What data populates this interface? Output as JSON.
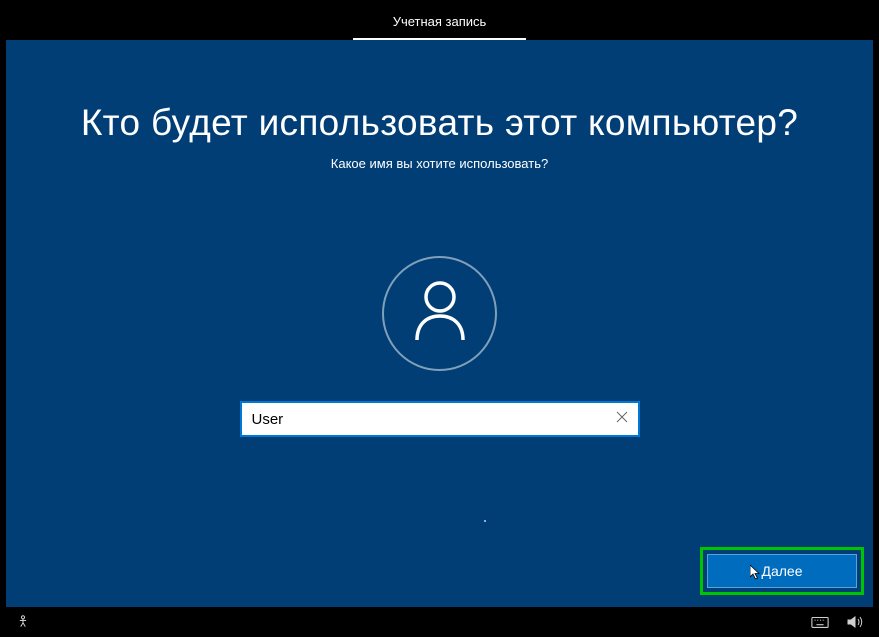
{
  "header": {
    "tab_label": "Учетная запись"
  },
  "main": {
    "title": "Кто будет использовать этот компьютер?",
    "subtitle": "Какое имя вы хотите использовать?",
    "name_input": {
      "value": "User",
      "placeholder": ""
    },
    "next_button_label": "Далее"
  },
  "colors": {
    "background": "#003E75",
    "accent": "#0078D7",
    "highlight": "#00c400"
  }
}
